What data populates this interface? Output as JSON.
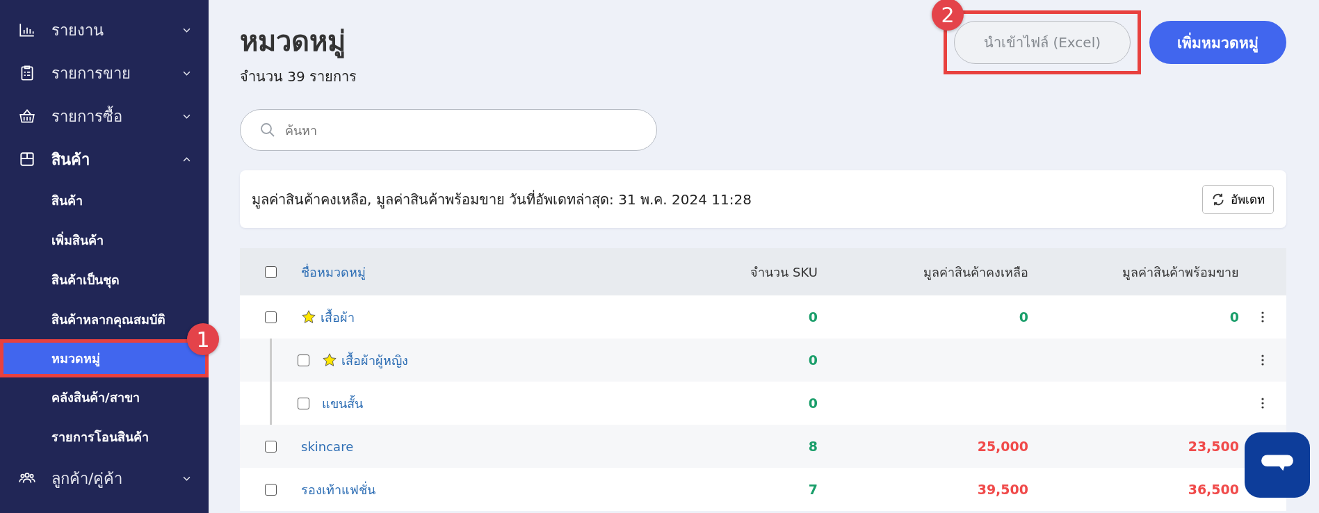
{
  "sidebar": {
    "items": [
      {
        "label": "รายงาน",
        "expanded": false
      },
      {
        "label": "รายการขาย",
        "expanded": false
      },
      {
        "label": "รายการซื้อ",
        "expanded": false
      },
      {
        "label": "สินค้า",
        "expanded": true,
        "children": [
          {
            "label": "สินค้า",
            "selected": false
          },
          {
            "label": "เพิ่มสินค้า",
            "selected": false
          },
          {
            "label": "สินค้าเป็นชุด",
            "selected": false
          },
          {
            "label": "สินค้าหลากคุณสมบัติ",
            "selected": false
          },
          {
            "label": "หมวดหมู่",
            "selected": true,
            "callout": "1"
          },
          {
            "label": "คลังสินค้า/สาขา",
            "selected": false
          },
          {
            "label": "รายการโอนสินค้า",
            "selected": false
          }
        ]
      },
      {
        "label": "ลูกค้า/คู่ค้า",
        "expanded": false
      }
    ]
  },
  "header": {
    "title": "หมวดหมู่",
    "count": "จำนวน 39 รายการ"
  },
  "buttons": {
    "import": {
      "label": "นำเข้าไฟล์ (Excel)",
      "callout": "2"
    },
    "add": {
      "label": "เพิ่มหมวดหมู่"
    }
  },
  "search": {
    "placeholder": "ค้นหา"
  },
  "info": {
    "text": "มูลค่าสินค้าคงเหลือ, มูลค่าสินค้าพร้อมขาย วันที่อัพเดทล่าสุด: 31 พ.ค. 2024 11:28",
    "button": "อัพเดท"
  },
  "table": {
    "header_checked": false,
    "columns": [
      "ชื่อหมวดหมู่",
      "จำนวน SKU",
      "มูลค่าสินค้าคงเหลือ",
      "มูลค่าสินค้าพร้อมขาย"
    ],
    "rows": [
      {
        "name": "เสื้อผ้า",
        "starred": true,
        "checked": false,
        "menu": true,
        "sku": {
          "text": "0",
          "color": "#1a9e6a"
        },
        "remaining": {
          "text": "0",
          "color": "#1a9e6a"
        },
        "ready": {
          "text": "0",
          "color": "#1a9e6a"
        },
        "children": [
          {
            "name": "เสื้อผ้าผู้หญิง",
            "starred": true,
            "checked": false,
            "menu": true,
            "sku": {
              "text": "0",
              "color": "#1a9e6a"
            }
          },
          {
            "name": "แขนสั้น",
            "starred": false,
            "checked": false,
            "menu": true,
            "sku": {
              "text": "0",
              "color": "#1a9e6a"
            }
          }
        ]
      },
      {
        "name": "skincare",
        "starred": false,
        "checked": false,
        "sku": {
          "text": "8",
          "color": "#1a9e6a"
        },
        "remaining": {
          "text": "25,000",
          "color": "#f04a4a"
        },
        "ready": {
          "text": "23,500",
          "color": "#f04a4a"
        }
      },
      {
        "name": "รองเท้าแฟชั่น",
        "starred": false,
        "checked": false,
        "sku": {
          "text": "7",
          "color": "#1a9e6a"
        },
        "remaining": {
          "text": "39,500",
          "color": "#f04a4a"
        },
        "ready": {
          "text": "36,500",
          "color": "#f04a4a"
        }
      }
    ]
  }
}
